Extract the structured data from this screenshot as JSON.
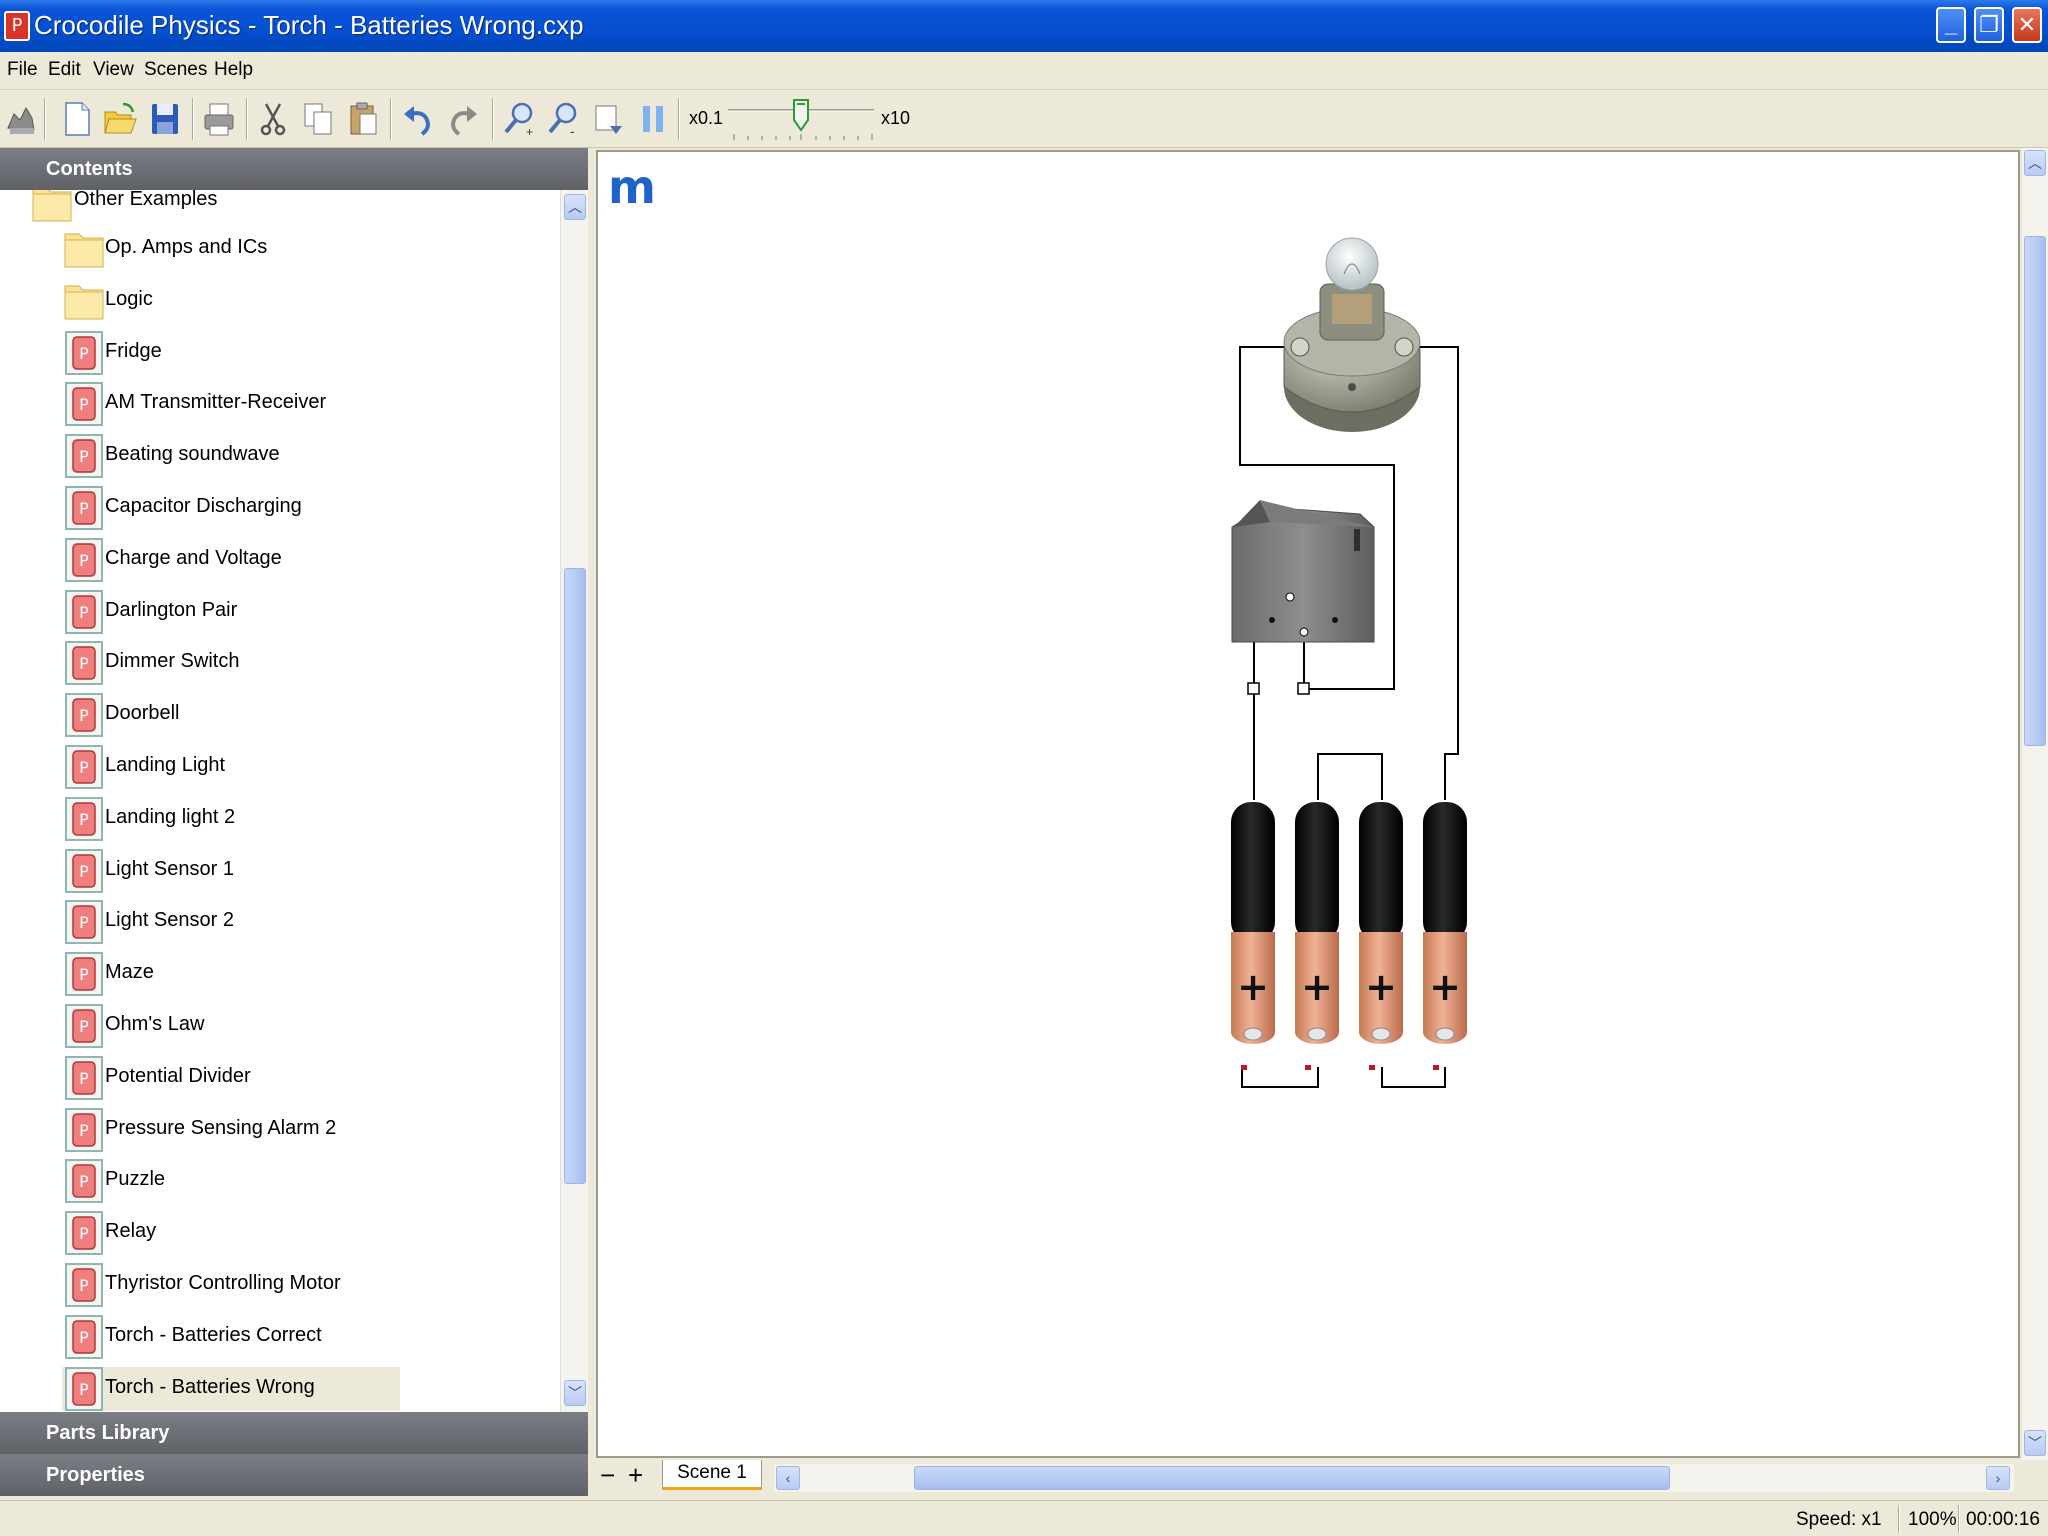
{
  "window": {
    "title": "Crocodile Physics - Torch - Batteries Wrong.cxp",
    "app_icon_letter": "P"
  },
  "menu": [
    "File",
    "Edit",
    "View",
    "Scenes",
    "Help"
  ],
  "toolbar": {
    "speed_min_label": "x0.1",
    "speed_max_label": "x10"
  },
  "panels": {
    "contents": "Contents",
    "parts_library": "Parts Library",
    "properties": "Properties"
  },
  "tree": {
    "partial_top": {
      "label": "Other Examples",
      "type": "folder"
    },
    "items": [
      {
        "label": "Op. Amps and ICs",
        "type": "folder"
      },
      {
        "label": "Logic",
        "type": "folder"
      },
      {
        "label": "Fridge",
        "type": "file"
      },
      {
        "label": "AM Transmitter-Receiver",
        "type": "file"
      },
      {
        "label": "Beating soundwave",
        "type": "file"
      },
      {
        "label": "Capacitor Discharging",
        "type": "file"
      },
      {
        "label": "Charge and Voltage",
        "type": "file"
      },
      {
        "label": "Darlington Pair",
        "type": "file"
      },
      {
        "label": "Dimmer Switch",
        "type": "file"
      },
      {
        "label": "Doorbell",
        "type": "file"
      },
      {
        "label": "Landing Light",
        "type": "file"
      },
      {
        "label": "Landing light 2",
        "type": "file"
      },
      {
        "label": "Light Sensor 1",
        "type": "file"
      },
      {
        "label": "Light Sensor 2",
        "type": "file"
      },
      {
        "label": "Maze",
        "type": "file"
      },
      {
        "label": "Ohm's Law",
        "type": "file"
      },
      {
        "label": "Potential Divider",
        "type": "file"
      },
      {
        "label": "Pressure Sensing Alarm 2",
        "type": "file"
      },
      {
        "label": "Puzzle",
        "type": "file"
      },
      {
        "label": "Relay",
        "type": "file"
      },
      {
        "label": "Thyristor Controlling Motor",
        "type": "file"
      },
      {
        "label": "Torch - Batteries Correct",
        "type": "file"
      },
      {
        "label": "Torch - Batteries Wrong",
        "type": "file",
        "selected": true
      }
    ]
  },
  "canvas": {
    "logo": "m",
    "battery_symbol": "+"
  },
  "scenes": {
    "minus": "−",
    "plus": "+",
    "tabs": [
      "Scene 1"
    ]
  },
  "status": {
    "speed": "Speed: x1",
    "zoom": "100%",
    "time": "00:00:16"
  },
  "colors": {
    "titlebar": "#0350d0",
    "panel_header": "#6b6e75",
    "battery_body": "#111111",
    "battery_tip": "#e8a07c",
    "wire": "#000000",
    "scene_tab_accent": "#f2a21a"
  }
}
